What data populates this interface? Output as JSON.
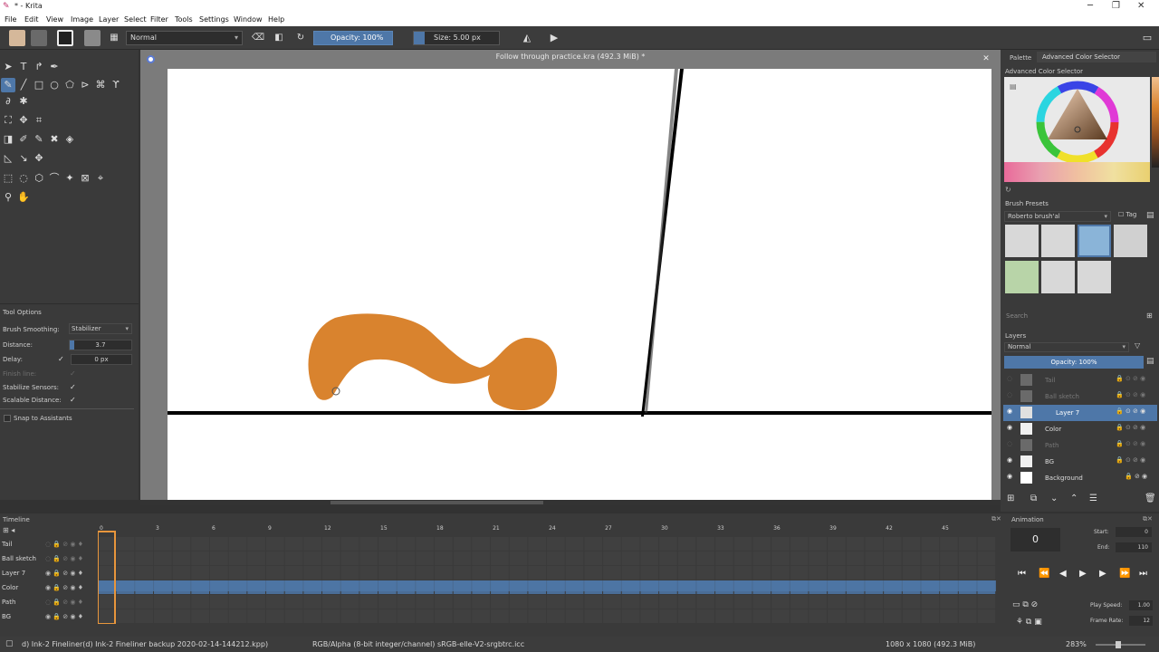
{
  "window": {
    "title": "* - Krita",
    "minimize": "─",
    "restore": "❐",
    "close": "✕"
  },
  "menu": [
    "File",
    "Edit",
    "View",
    "Image",
    "Layer",
    "Select",
    "Filter",
    "Tools",
    "Settings",
    "Window",
    "Help"
  ],
  "toolbar": {
    "blend_mode": "Normal",
    "opacity": "Opacity: 100%",
    "size": "Size: 5.00 px"
  },
  "document": {
    "title": "Follow through practice.kra (492.3 MiB) *"
  },
  "tool_options": {
    "title": "Tool Options",
    "brush_smoothing_label": "Brush Smoothing:",
    "brush_smoothing_value": "Stabilizer",
    "distance_label": "Distance:",
    "distance_value": "3.7",
    "delay_label": "Delay:",
    "delay_value": "0 px",
    "finish_line_label": "Finish line:",
    "stabilize_sensors_label": "Stabilize Sensors:",
    "scalable_distance_label": "Scalable Distance:",
    "snap_label": "Snap to Assistants"
  },
  "right_tabs": {
    "palette": "Palette",
    "advanced": "Advanced Color Selector"
  },
  "color_selector": {
    "title": "Advanced Color Selector"
  },
  "brush_presets": {
    "title": "Brush Presets",
    "current": "Roberto brush'al",
    "tag": "Tag",
    "search_placeholder": "Search"
  },
  "layers_panel": {
    "title": "Layers",
    "blend": "Normal",
    "opacity": "Opacity: 100%",
    "layers": [
      {
        "name": "Tail",
        "visible": false,
        "selected": false
      },
      {
        "name": "Ball sketch",
        "visible": false,
        "selected": false
      },
      {
        "name": "Layer 7",
        "visible": true,
        "selected": true
      },
      {
        "name": "Color",
        "visible": true,
        "selected": false
      },
      {
        "name": "Path",
        "visible": false,
        "selected": false
      },
      {
        "name": "BG",
        "visible": true,
        "selected": false
      },
      {
        "name": "Background",
        "visible": true,
        "selected": false
      }
    ]
  },
  "timeline": {
    "title": "Timeline",
    "ticks": [
      "0",
      "3",
      "6",
      "9",
      "12",
      "15",
      "18",
      "21",
      "24",
      "27",
      "30",
      "33",
      "36",
      "39",
      "42",
      "45"
    ],
    "rows": [
      "Tail",
      "Ball sketch",
      "Layer 7",
      "Color",
      "Path",
      "BG"
    ]
  },
  "animation": {
    "title": "Animation",
    "frame": "0",
    "start_label": "Start:",
    "start": "0",
    "end_label": "End:",
    "end": "110",
    "play_speed_label": "Play Speed:",
    "play_speed": "1.00",
    "frame_rate_label": "Frame Rate:",
    "frame_rate": "12"
  },
  "status": {
    "brush": "d) Ink-2 Fineliner(d) Ink-2 Fineliner backup 2020-02-14-144212.kpp)",
    "color_space": "RGB/Alpha (8-bit integer/channel)  sRGB-elle-V2-srgbtrc.icc",
    "dimensions": "1080 x 1080 (492.3 MiB)",
    "zoom": "283%"
  },
  "colors": {
    "accent": "#4e77a8",
    "paint": "#d9832e",
    "selection": "#e8963c"
  }
}
